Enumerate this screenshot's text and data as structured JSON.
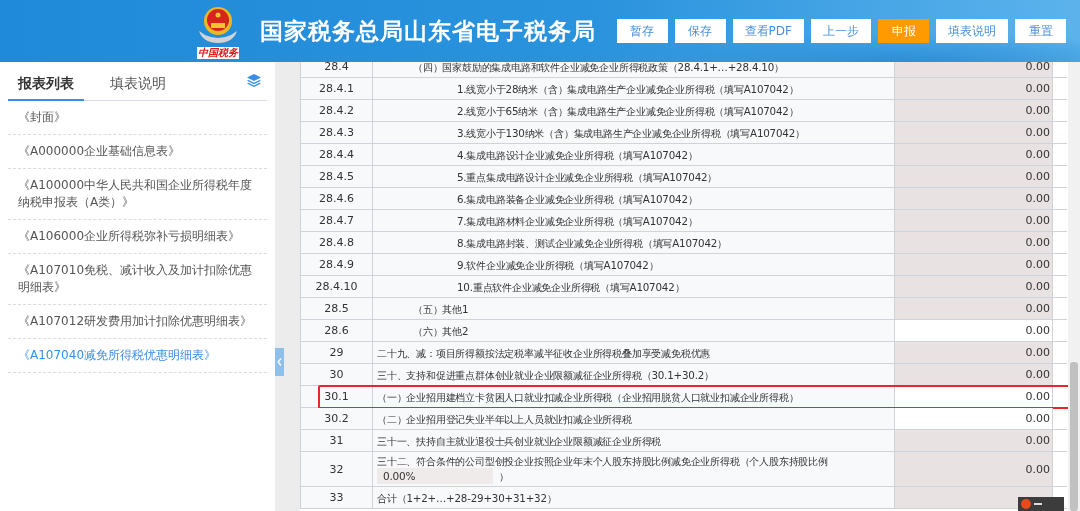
{
  "header": {
    "emblem_text": "中国税务",
    "title": "国家税务总局山东省电子税务局",
    "buttons": [
      {
        "label": "暂存",
        "kind": "normal"
      },
      {
        "label": "保存",
        "kind": "normal"
      },
      {
        "label": "查看PDF",
        "kind": "normal"
      },
      {
        "label": "上一步",
        "kind": "normal"
      },
      {
        "label": "申报",
        "kind": "primary"
      },
      {
        "label": "填表说明",
        "kind": "normal"
      },
      {
        "label": "重置",
        "kind": "normal"
      }
    ]
  },
  "sidebar": {
    "tabs": [
      {
        "label": "报表列表",
        "selected": true
      },
      {
        "label": "填表说明",
        "selected": false
      }
    ],
    "items": [
      {
        "label": "《封面》",
        "selected": false
      },
      {
        "label": "《A000000企业基础信息表》",
        "selected": false
      },
      {
        "label": "《A100000中华人民共和国企业所得税年度纳税申报表（A类）》",
        "selected": false
      },
      {
        "label": "《A106000企业所得税弥补亏损明细表》",
        "selected": false
      },
      {
        "label": "《A107010免税、减计收入及加计扣除优惠明细表》",
        "selected": false
      },
      {
        "label": "《A107012研发费用加计扣除优惠明细表》",
        "selected": false
      },
      {
        "label": "《A107040减免所得税优惠明细表》",
        "selected": true
      }
    ]
  },
  "table": {
    "rows": [
      {
        "no": "28.4",
        "kind": "item",
        "text": "（四）国家鼓励的集成电路和软件企业减免企业所得税政策（28.4.1+…+28.4.10）",
        "value": "0.00",
        "editable": false,
        "highlighted": false,
        "children": [
          {
            "no": "28.4.1",
            "text": "1.线宽小于28纳米（含）集成电路生产企业减免企业所得税（填写A107042）",
            "value": "0.00",
            "editable": false,
            "highlighted": false
          },
          {
            "no": "28.4.2",
            "text": "2.线宽小于65纳米（含）集成电路生产企业减免企业所得税（填写A107042）",
            "value": "0.00",
            "editable": false,
            "highlighted": false
          },
          {
            "no": "28.4.3",
            "text": "3.线宽小于130纳米（含）集成电路生产企业减免企业所得税（填写A107042）",
            "value": "0.00",
            "editable": false,
            "highlighted": false
          },
          {
            "no": "28.4.4",
            "text": "4.集成电路设计企业减免企业所得税（填写A107042）",
            "value": "0.00",
            "editable": false,
            "highlighted": false
          },
          {
            "no": "28.4.5",
            "text": "5.重点集成电路设计企业减免企业所得税（填写A107042）",
            "value": "0.00",
            "editable": false,
            "highlighted": false
          },
          {
            "no": "28.4.6",
            "text": "6.集成电路装备企业减免企业所得税（填写A107042）",
            "value": "0.00",
            "editable": false,
            "highlighted": false
          },
          {
            "no": "28.4.7",
            "text": "7.集成电路材料企业减免企业所得税（填写A107042）",
            "value": "0.00",
            "editable": false,
            "highlighted": false
          },
          {
            "no": "28.4.8",
            "text": "8.集成电路封装、测试企业减免企业所得税（填写A107042）",
            "value": "0.00",
            "editable": false,
            "highlighted": false
          },
          {
            "no": "28.4.9",
            "text": "9.软件企业减免企业所得税（填写A107042）",
            "value": "0.00",
            "editable": false,
            "highlighted": false
          },
          {
            "no": "28.4.10",
            "text": "10.重点软件企业减免企业所得税（填写A107042）",
            "value": "0.00",
            "editable": false,
            "highlighted": false
          }
        ]
      },
      {
        "no": "28.5",
        "kind": "item",
        "text": "（五）其他1",
        "value": "0.00",
        "editable": false,
        "highlighted": false
      },
      {
        "no": "28.6",
        "kind": "item",
        "text": "（六）其他2",
        "value": "0.00",
        "editable": true,
        "highlighted": false
      },
      {
        "no": "29",
        "kind": "section",
        "text": "二十九、减：项目所得额按法定税率减半征收企业所得税叠加享受减免税优惠",
        "value": "0.00",
        "editable": false,
        "highlighted": false
      },
      {
        "no": "30",
        "kind": "section",
        "text": "三十、支持和促进重点群体创业就业企业限额减征企业所得税（30.1+30.2）",
        "value": "0.00",
        "editable": false,
        "highlighted": false,
        "children": [
          {
            "no": "30.1",
            "text": "（一）企业招用建档立卡贫困人口就业扣减企业所得税（企业招用脱贫人口就业扣减企业所得税）",
            "value": "0.00",
            "editable": true,
            "highlighted": true
          },
          {
            "no": "30.2",
            "text": "（二）企业招用登记失业半年以上人员就业扣减企业所得税",
            "value": "0.00",
            "editable": true,
            "highlighted": false
          }
        ]
      },
      {
        "no": "31",
        "kind": "section",
        "text": "三十一、扶持自主就业退役士兵创业就业企业限额减征企业所得税",
        "value": "0.00",
        "editable": false,
        "highlighted": false
      },
      {
        "no": "32",
        "kind": "section",
        "text": "三十二、符合条件的公司型创投企业按照企业年末个人股东持股比例减免企业所得税（个人股东持股比例",
        "percent": "0.00%",
        "text_end": "）",
        "value": "0.00",
        "editable": false,
        "highlighted": false
      },
      {
        "no": "33",
        "kind": "section",
        "text": "合计（1+2+…+28-29+30+31+32）",
        "editable": false,
        "highlighted": false
      }
    ]
  }
}
